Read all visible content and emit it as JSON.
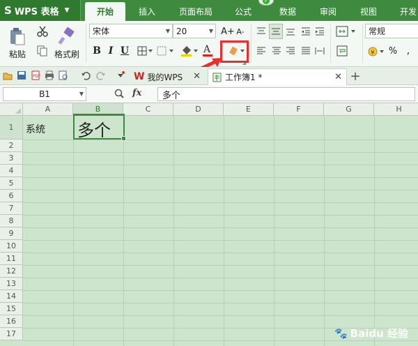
{
  "app": {
    "name": "WPS 表格"
  },
  "menu_tabs": [
    "开始",
    "插入",
    "页面布局",
    "公式",
    "数据",
    "审阅",
    "视图",
    "开发"
  ],
  "ribbon": {
    "paste_label": "粘贴",
    "format_painter_label": "格式刷",
    "font_name": "宋体",
    "font_size": "20",
    "number_format": "常规",
    "grow_font_label": "A+",
    "shrink_font_label": "A-",
    "bold": "B",
    "italic": "I",
    "underline": "U",
    "percent": "%",
    "comma": ","
  },
  "doc_tabs": [
    {
      "label": "我的WPS",
      "active": false
    },
    {
      "label": "工作簿1 *",
      "active": true
    }
  ],
  "formula_bar": {
    "name_box": "B1",
    "fx": "fx",
    "content": "多个"
  },
  "sheet": {
    "columns": [
      "A",
      "B",
      "C",
      "D",
      "E",
      "F",
      "G",
      "H"
    ],
    "rows": [
      "1",
      "2",
      "3",
      "4",
      "5",
      "6",
      "7",
      "8",
      "9",
      "10",
      "11",
      "12",
      "13",
      "14",
      "15",
      "16",
      "17"
    ],
    "selected_column": "B",
    "selected_row": "1",
    "cells": {
      "A1": "系统",
      "B1": "多个"
    }
  },
  "watermark": "Baidu 经验",
  "colors": {
    "brand_green": "#3e8a3e",
    "sheet_bg": "#cce5cc",
    "highlight_red": "#e83030"
  }
}
